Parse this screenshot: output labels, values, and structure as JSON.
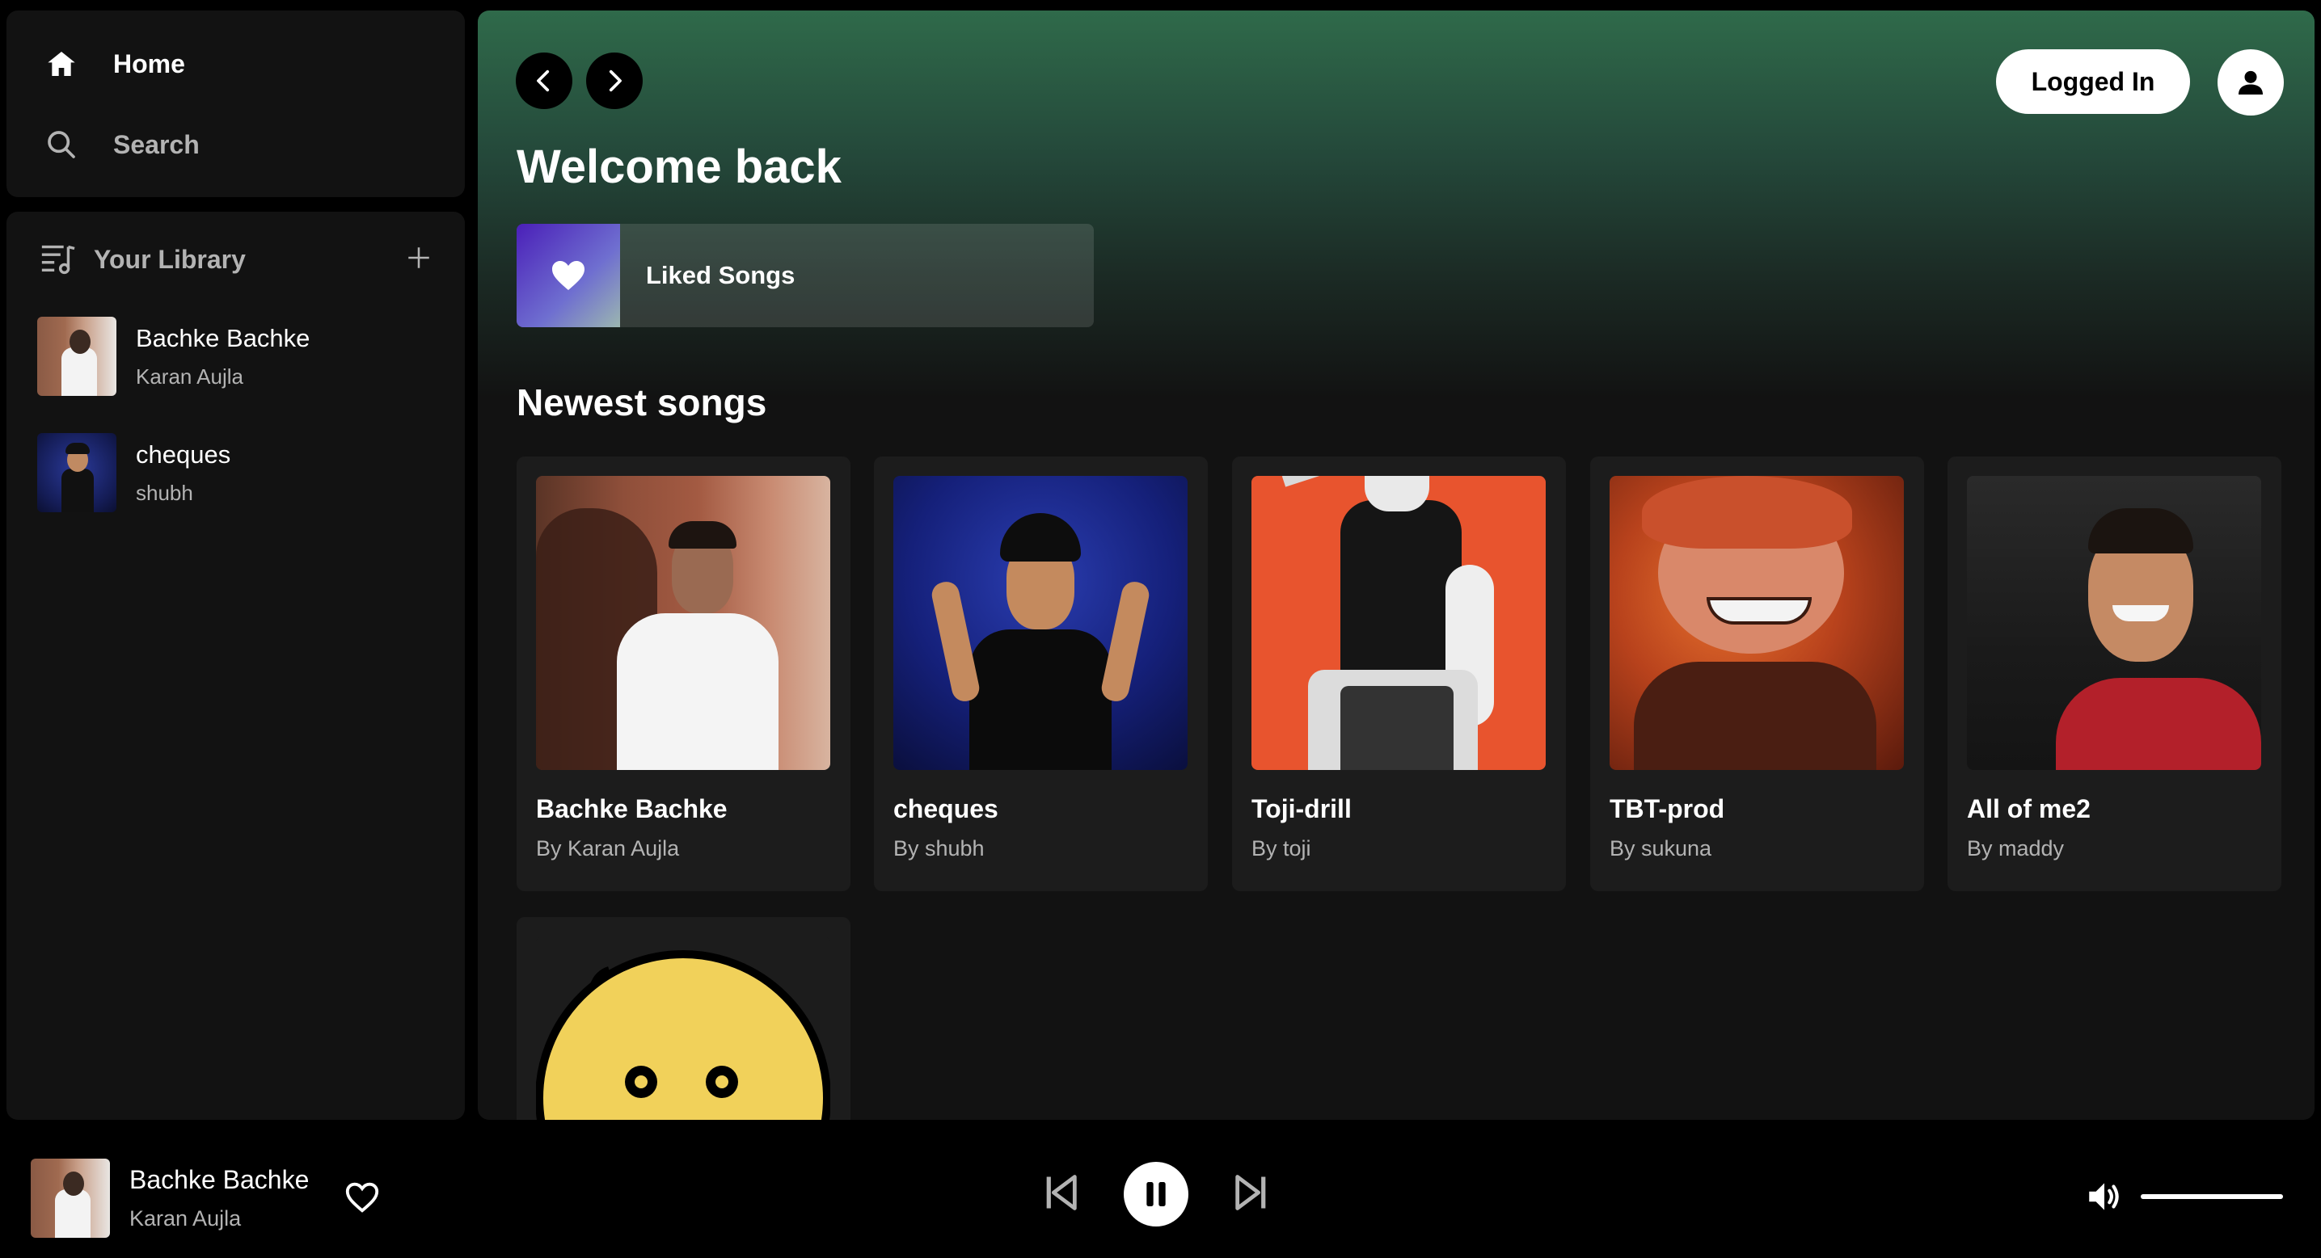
{
  "sidebar": {
    "nav": [
      {
        "label": "Home",
        "icon": "home-icon"
      },
      {
        "label": "Search",
        "icon": "search-icon"
      }
    ],
    "library": {
      "label": "Your Library",
      "items": [
        {
          "title": "Bachke Bachke",
          "artist": "Karan Aujla"
        },
        {
          "title": "cheques",
          "artist": "shubh"
        }
      ]
    }
  },
  "header": {
    "login_label": "Logged In",
    "welcome": "Welcome back",
    "liked_songs": "Liked Songs"
  },
  "main": {
    "section_title": "Newest songs",
    "songs": [
      {
        "title": "Bachke Bachke",
        "by": "By Karan Aujla"
      },
      {
        "title": "cheques",
        "by": "By shubh"
      },
      {
        "title": "Toji-drill",
        "by": "By toji"
      },
      {
        "title": "TBT-prod",
        "by": "By sukuna"
      },
      {
        "title": "All of me2",
        "by": "By maddy"
      }
    ]
  },
  "player": {
    "title": "Bachke Bachke",
    "artist": "Karan Aujla",
    "volume": 1.0
  },
  "colors": {
    "accent_green": "#2f6a4a",
    "background": "#121212",
    "card": "#1c1c1c",
    "muted_text": "#b3b3b3"
  }
}
